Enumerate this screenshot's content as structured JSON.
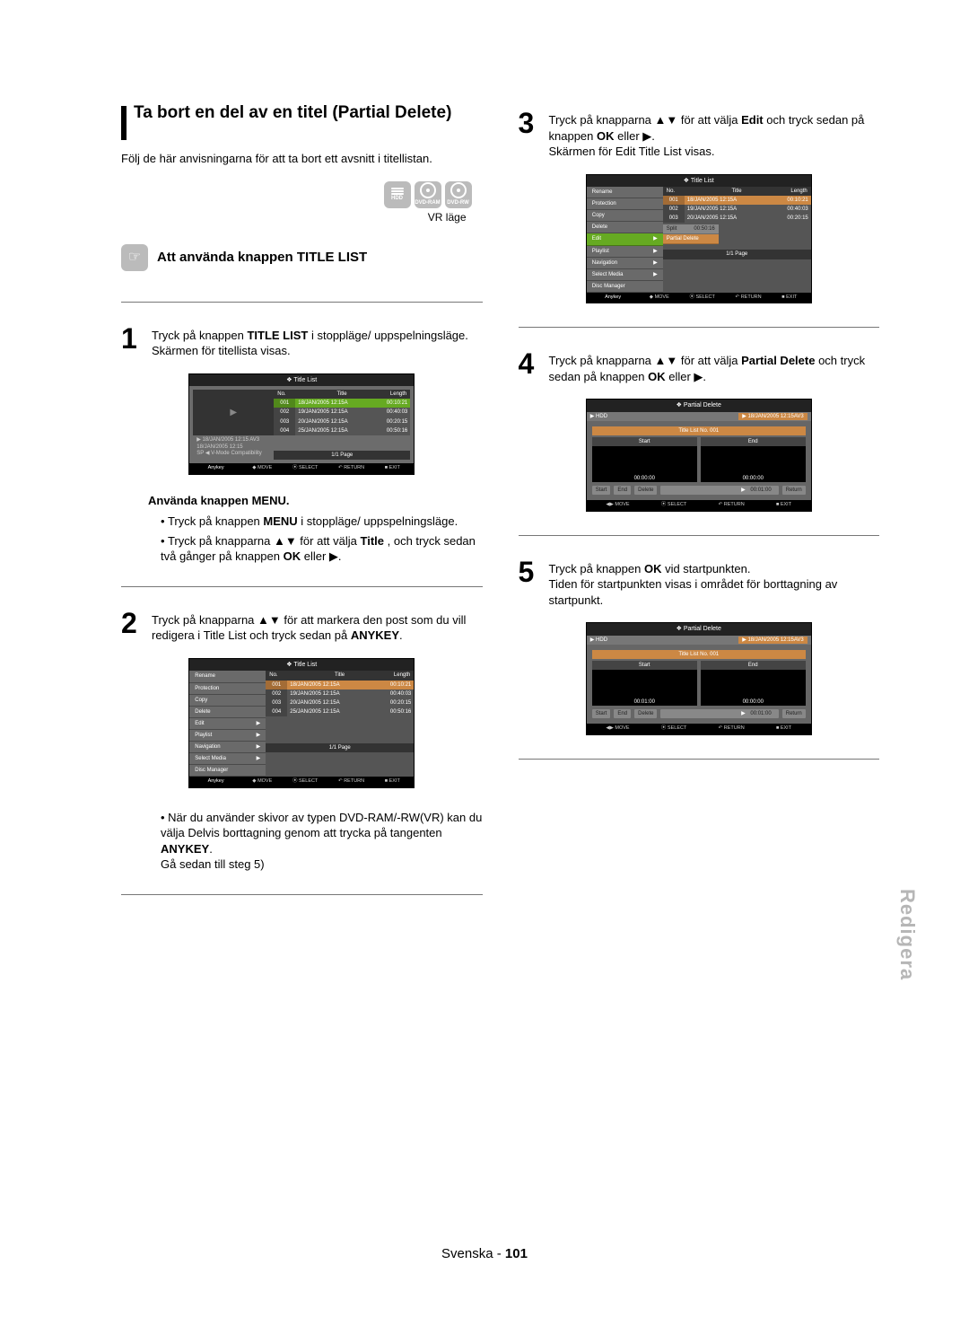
{
  "heading": "Ta bort en del av en titel (Partial Delete)",
  "intro": "Följ de här anvisningarna för att ta bort ett avsnitt i titellistan.",
  "disc_icons": {
    "hdd": "HDD",
    "ram": "DVD-RAM",
    "rw": "DVD-RW"
  },
  "vr_mode": "VR läge",
  "hand_label": "☞",
  "subheading": "Att använda knappen TITLE LIST",
  "steps": {
    "s1a": "Tryck på knappen ",
    "s1b": "TITLE LIST",
    "s1c": " i stoppläge/ uppspelningsläge.",
    "s1d": "Skärmen för titellista visas.",
    "s2a": "Tryck på knapparna ▲▼ för att markera den post som du vill redigera i Title List och tryck sedan på ",
    "s2b": "ANYKEY",
    "s2c": ".",
    "s3a": "Tryck på knapparna ▲▼ för att välja ",
    "s3b": "Edit",
    "s3c": " och tryck sedan på knappen ",
    "s3d": "OK",
    "s3e": " eller ▶.",
    "s3f": "Skärmen för Edit Title List visas.",
    "s4a": "Tryck på knapparna ▲▼ för att välja ",
    "s4b": "Partial Delete",
    "s4c": " och tryck sedan på knappen ",
    "s4d": "OK",
    "s4e": " eller ▶.",
    "s5a": "Tryck på knappen ",
    "s5b": "OK",
    "s5c": " vid startpunkten.",
    "s5d": "Tiden för startpunkten visas i området för borttagning av startpunkt."
  },
  "menubox": {
    "title": "Använda knappen MENU.",
    "li1a": "Tryck på knappen ",
    "li1b": "MENU",
    "li1c": " i stoppläge/ uppspelningsläge.",
    "li2a": "Tryck på knapparna ▲▼ för att välja ",
    "li2b": "Title",
    "li2c": " , och tryck sedan två gånger på knappen ",
    "li2d": "OK",
    "li2e": " eller ▶."
  },
  "note_below_screen2": {
    "a": "När du använder skivor av typen DVD-RAM/-RW(VR) kan du välja Delvis borttagning genom att trycka på tangenten ",
    "b": "ANYKEY",
    "c": ".",
    "d": "Gå sedan till steg 5)"
  },
  "title_list_screen": {
    "title": "Title List",
    "hdd": "HDD",
    "cols": {
      "no": "No.",
      "title": "Title",
      "len": "Length"
    },
    "rows": [
      {
        "n": "001",
        "t": "18/JAN/2005 12:15A",
        "l": "00:10:21"
      },
      {
        "n": "002",
        "t": "19/JAN/2005 12:15A",
        "l": "00:40:03"
      },
      {
        "n": "003",
        "t": "20/JAN/2005 12:15A",
        "l": "00:20:15"
      },
      {
        "n": "004",
        "t": "25/JAN/2005 12:15A",
        "l": "00:50:16"
      }
    ],
    "info1": "18/JAN/2005 12:15 AV3",
    "info2": "18/JAN/2005 12:15",
    "info3": "SP ◀ V-Mode Compatibility",
    "page": "1/1 Page",
    "anykey": "Anykey",
    "move": "MOVE",
    "select": "SELECT",
    "return": "RETURN",
    "exit": "EXIT"
  },
  "edit_menu_items": [
    "Rename",
    "Protection",
    "Copy",
    "Delete",
    "Edit",
    "Playlist",
    "Navigation",
    "Select Media",
    "Disc Manager"
  ],
  "edit_menu_rows3": [
    {
      "n": "001",
      "t": "18/JAN/2005 12:15A",
      "l": "00:10:21"
    },
    {
      "n": "002",
      "t": "19/JAN/2005 12:15A",
      "l": "00:40:03"
    },
    {
      "n": "003",
      "t": "20/JAN/2005 12:15A",
      "l": "00:20:15"
    }
  ],
  "submenu": {
    "split": "Split",
    "split_len": "00:50:16",
    "pd": "Partial Delete"
  },
  "pd_screen": {
    "title": "Partial Delete",
    "hdd": "HDD",
    "clip": "18/JAN/2005 12:15AV3",
    "sub": "Title List No. 001",
    "start": "Start",
    "end": "End",
    "pd1_start_time": "00:00:00",
    "pd1_end_time": "00:00:00",
    "pd1_total": "00:01:00",
    "pd2_start_time": "00:01:00",
    "pd2_end_time": "00:00:00",
    "pd2_total": "00:01:00",
    "btn_start": "Start",
    "btn_end": "End",
    "btn_delete": "Delete",
    "btn_return": "Return"
  },
  "side_tab": "Redigera",
  "footer_lang": "Svenska",
  "footer_page": "101"
}
